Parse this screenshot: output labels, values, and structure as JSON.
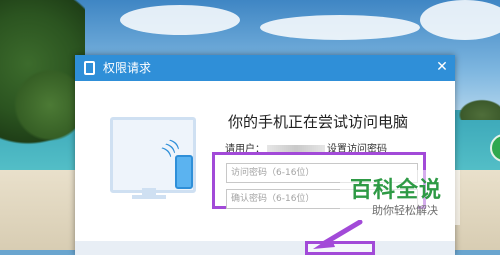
{
  "dialog": {
    "title": "权限请求",
    "close_symbol": "✕",
    "heading": "你的手机正在尝试访问电脑",
    "prompt_prefix": "请用户：",
    "prompt_suffix": "设置访问密码",
    "password_placeholder": "访问密码（6-16位）",
    "confirm_placeholder": "确认密码（6-16位）"
  },
  "watermark": {
    "title": "百科全说",
    "subtitle": "助你轻松解决"
  },
  "colors": {
    "titlebar": "#2f8fd8",
    "highlight": "#a24ad8",
    "watermark_green": "#2e9a45"
  },
  "icons": {
    "app": "tablet-icon",
    "close": "close-icon",
    "illustration": "monitor-phone-icon"
  }
}
